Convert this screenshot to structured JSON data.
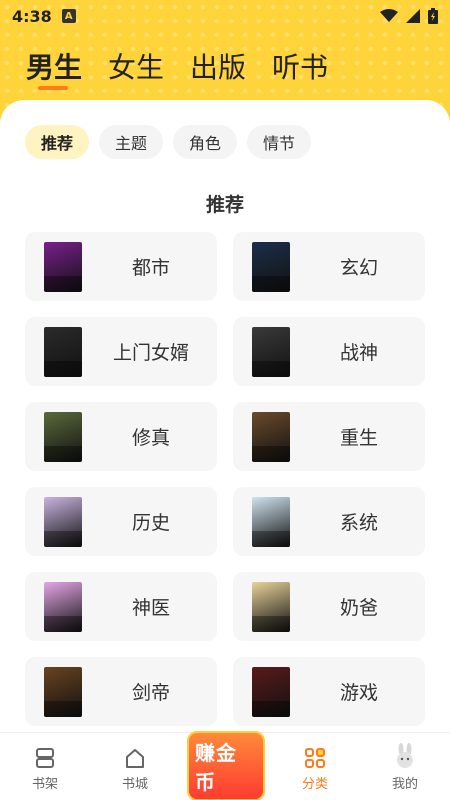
{
  "status": {
    "time": "4:38",
    "app_badge": "A"
  },
  "channel_tabs": [
    {
      "label": "男生",
      "active": true
    },
    {
      "label": "女生",
      "active": false
    },
    {
      "label": "出版",
      "active": false
    },
    {
      "label": "听书",
      "active": false
    }
  ],
  "filters": [
    {
      "label": "推荐",
      "active": true
    },
    {
      "label": "主题",
      "active": false
    },
    {
      "label": "角色",
      "active": false
    },
    {
      "label": "情节",
      "active": false
    }
  ],
  "section_title": "推荐",
  "genres": [
    {
      "label": "都市",
      "cover_color": "#7a1f8c"
    },
    {
      "label": "玄幻",
      "cover_color": "#1c2f4a"
    },
    {
      "label": "上门女婿",
      "cover_color": "#2b2b2b"
    },
    {
      "label": "战神",
      "cover_color": "#3a3a3a"
    },
    {
      "label": "修真",
      "cover_color": "#5a6a3a"
    },
    {
      "label": "重生",
      "cover_color": "#6b4a2a"
    },
    {
      "label": "历史",
      "cover_color": "#c9b4e0"
    },
    {
      "label": "系统",
      "cover_color": "#cfe3ef"
    },
    {
      "label": "神医",
      "cover_color": "#e6a6e8"
    },
    {
      "label": "奶爸",
      "cover_color": "#e9d29a"
    },
    {
      "label": "剑帝",
      "cover_color": "#6a4320"
    },
    {
      "label": "游戏",
      "cover_color": "#5a1a1a"
    }
  ],
  "bottom_nav": [
    {
      "label": "书架",
      "icon": "bookshelf-icon",
      "active": false
    },
    {
      "label": "书城",
      "icon": "home-icon",
      "active": false
    },
    {
      "label": "",
      "icon": "earn-coins-icon",
      "active": false
    },
    {
      "label": "分类",
      "icon": "category-grid-icon",
      "active": true
    },
    {
      "label": "我的",
      "icon": "profile-rabbit-icon",
      "active": false
    }
  ],
  "coin_badge": {
    "label": "赚金币"
  },
  "colors": {
    "accent": "#ff7a1a",
    "header_bg": "#ffd43b",
    "chip_active": "#fff3c2"
  }
}
